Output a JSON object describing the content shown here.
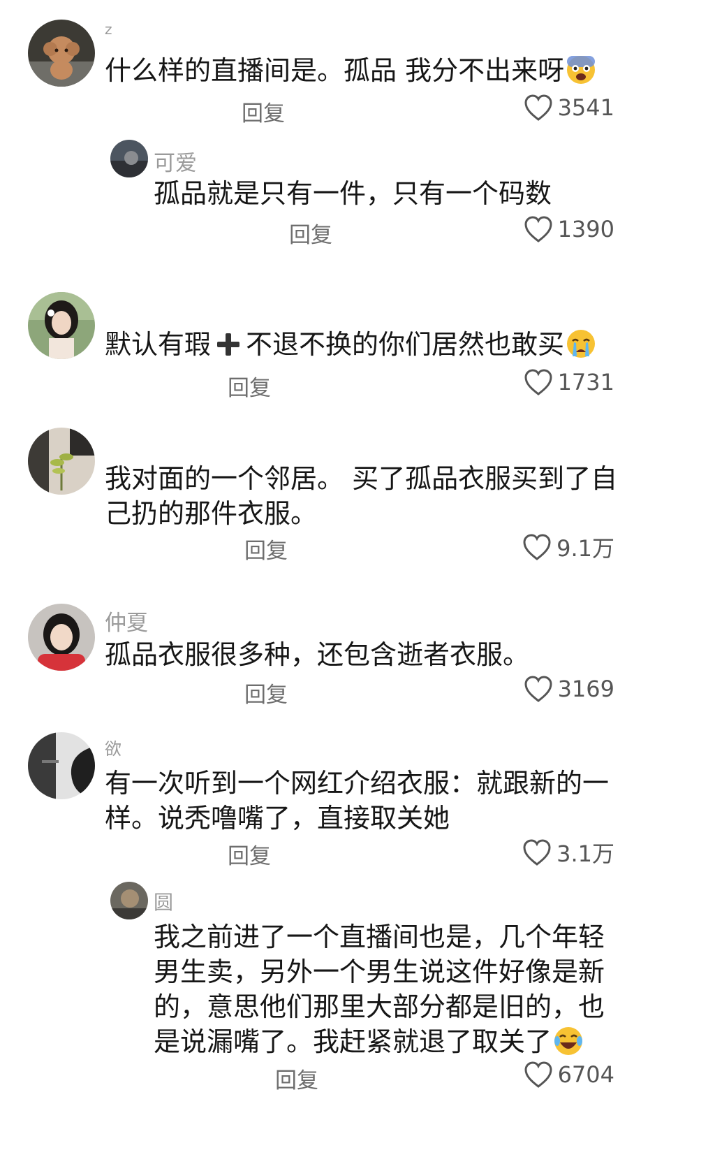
{
  "comments": [
    {
      "username": "z",
      "text": "什么样的直播间是。孤品 我分不出来呀",
      "reply_label": "回复",
      "likes": "3541",
      "emoji": "fearful-face"
    },
    {
      "username": "可爱",
      "text": "孤品就是只有一件，只有一个码数",
      "reply_label": "回复",
      "likes": "1390"
    },
    {
      "username": "",
      "text_before": "默认有瑕",
      "text_after": "不退不换的你们居然也敢买",
      "reply_label": "回复",
      "likes": "1731",
      "emoji": "crying-face"
    },
    {
      "username": "",
      "text": "我对面的一个邻居。 买了孤品衣服买到了自己扔的那件衣服。",
      "reply_label": "回复",
      "likes": "9.1万"
    },
    {
      "username": "仲夏",
      "text": "孤品衣服很多种，还包含逝者衣服。",
      "reply_label": "回复",
      "likes": "3169"
    },
    {
      "username": "欲",
      "text": "有一次听到一个网红介绍衣服：就跟新的一样。说秃噜嘴了，直接取关她",
      "reply_label": "回复",
      "likes": "3.1万"
    },
    {
      "username": "圆",
      "text": "我之前进了一个直播间也是，几个年轻男生卖，另外一个男生说这件好像是新的，意思他们那里大部分都是旧的，也是说漏嘴了。我赶紧就退了取关了",
      "reply_label": "回复",
      "likes": "6704",
      "emoji": "laughing-tears-face"
    }
  ],
  "icons": {
    "like": "heart-outline-icon",
    "plus": "plus-icon"
  },
  "colors": {
    "text": "#161616",
    "username": "#9a9a9a",
    "reply": "#6e6e6e",
    "like": "#555555",
    "emoji_yellow": "#f7c233"
  }
}
